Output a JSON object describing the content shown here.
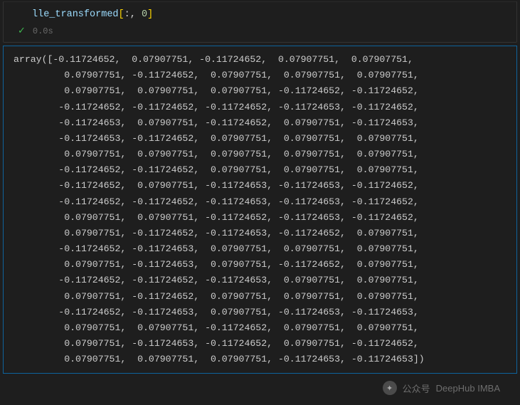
{
  "cell": {
    "code": {
      "identifier": "lle_transformed",
      "open_bracket": "[",
      "slice_op": ":",
      "comma": ", ",
      "index": "0",
      "close_bracket": "]"
    },
    "exec_time": "0.0s"
  },
  "output_prefix": "array([",
  "output_suffix": "])",
  "array_rows": [
    [
      "-0.11724652",
      " 0.07907751",
      "-0.11724652",
      " 0.07907751",
      " 0.07907751"
    ],
    [
      " 0.07907751",
      "-0.11724652",
      " 0.07907751",
      " 0.07907751",
      " 0.07907751"
    ],
    [
      " 0.07907751",
      " 0.07907751",
      " 0.07907751",
      "-0.11724652",
      "-0.11724652"
    ],
    [
      "-0.11724652",
      "-0.11724652",
      "-0.11724652",
      "-0.11724653",
      "-0.11724652"
    ],
    [
      "-0.11724653",
      " 0.07907751",
      "-0.11724652",
      " 0.07907751",
      "-0.11724653"
    ],
    [
      "-0.11724653",
      "-0.11724652",
      " 0.07907751",
      " 0.07907751",
      " 0.07907751"
    ],
    [
      " 0.07907751",
      " 0.07907751",
      " 0.07907751",
      " 0.07907751",
      " 0.07907751"
    ],
    [
      "-0.11724652",
      "-0.11724652",
      " 0.07907751",
      " 0.07907751",
      " 0.07907751"
    ],
    [
      "-0.11724652",
      " 0.07907751",
      "-0.11724653",
      "-0.11724653",
      "-0.11724652"
    ],
    [
      "-0.11724652",
      "-0.11724652",
      "-0.11724653",
      "-0.11724653",
      "-0.11724652"
    ],
    [
      " 0.07907751",
      " 0.07907751",
      "-0.11724652",
      "-0.11724653",
      "-0.11724652"
    ],
    [
      " 0.07907751",
      "-0.11724652",
      "-0.11724653",
      "-0.11724652",
      " 0.07907751"
    ],
    [
      "-0.11724652",
      "-0.11724653",
      " 0.07907751",
      " 0.07907751",
      " 0.07907751"
    ],
    [
      " 0.07907751",
      "-0.11724653",
      " 0.07907751",
      "-0.11724652",
      " 0.07907751"
    ],
    [
      "-0.11724652",
      "-0.11724652",
      "-0.11724653",
      " 0.07907751",
      " 0.07907751"
    ],
    [
      " 0.07907751",
      "-0.11724652",
      " 0.07907751",
      " 0.07907751",
      " 0.07907751"
    ],
    [
      "-0.11724652",
      "-0.11724653",
      " 0.07907751",
      "-0.11724653",
      "-0.11724653"
    ],
    [
      " 0.07907751",
      " 0.07907751",
      "-0.11724652",
      " 0.07907751",
      " 0.07907751"
    ],
    [
      " 0.07907751",
      "-0.11724653",
      "-0.11724652",
      " 0.07907751",
      "-0.11724652"
    ],
    [
      " 0.07907751",
      " 0.07907751",
      " 0.07907751",
      "-0.11724653",
      "-0.11724653"
    ]
  ],
  "watermark": {
    "prefix": "公众号",
    "text": "DeepHub IMBA"
  }
}
